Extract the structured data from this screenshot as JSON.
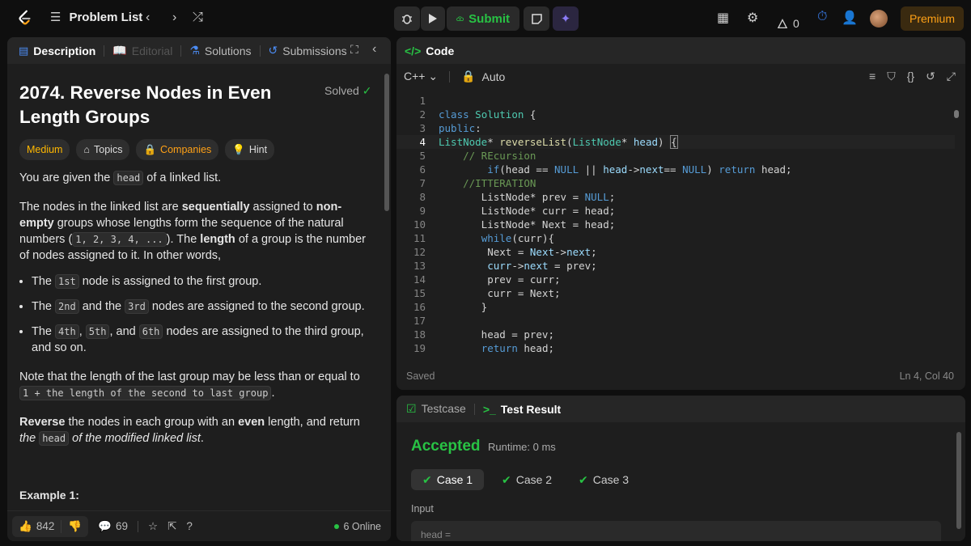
{
  "topbar": {
    "problem_list": "Problem List",
    "submit": "Submit",
    "streak": "0",
    "premium": "Premium"
  },
  "left_tabs": [
    {
      "label": "Description"
    },
    {
      "label": "Editorial"
    },
    {
      "label": "Solutions"
    },
    {
      "label": "Submissions"
    }
  ],
  "problem": {
    "title": "2074. Reverse Nodes in Even Length Groups",
    "status": "Solved",
    "chips": [
      "Medium",
      "Topics",
      "Companies",
      "Hint"
    ],
    "p1_a": "You are given the ",
    "p1_code": "head",
    "p1_b": " of a linked list.",
    "p2_a": "The nodes in the linked list are ",
    "p2_b1": "sequentially",
    "p2_c": " assigned to ",
    "p2_b2": "non-empty",
    "p2_d": " groups whose lengths form the sequence of the natural numbers (",
    "p2_code": "1, 2, 3, 4, ...",
    "p2_e": "). The ",
    "p2_b3": "length",
    "p2_f": " of a group is the number of nodes assigned to it. In other words,",
    "li1_a": "The ",
    "li1_code": "1st",
    "li1_b": " node is assigned to the first group.",
    "li2_a": "The ",
    "li2_code1": "2nd",
    "li2_b": " and the ",
    "li2_code2": "3rd",
    "li2_c": " nodes are assigned to the second group.",
    "li3_a": "The ",
    "li3_code1": "4th",
    "li3_b": ", ",
    "li3_code2": "5th",
    "li3_c": ", and ",
    "li3_code3": "6th",
    "li3_d": " nodes are assigned to the third group, and so on.",
    "p3_a": "Note that the length of the last group may be less than or equal to ",
    "p3_code": "1 + the length of the second to last group",
    "p3_b": ".",
    "p4_b1": "Reverse",
    "p4_a": " the nodes in each group with an ",
    "p4_b2": "even",
    "p4_c": " length, and return ",
    "p4_i1": "the",
    "p4_code": "head",
    "p4_i2": " of the modified linked list",
    "p4_d": ".",
    "example": "Example 1:"
  },
  "footer": {
    "likes": "842",
    "comments": "69",
    "online": "6 Online"
  },
  "code_panel": {
    "title": "Code",
    "language": "C++",
    "mode": "Auto",
    "status": "Saved",
    "cursor": "Ln 4, Col 40"
  },
  "result_panel": {
    "tab_testcase": "Testcase",
    "tab_result": "Test Result",
    "verdict": "Accepted",
    "runtime": "Runtime: 0 ms",
    "cases": [
      "Case 1",
      "Case 2",
      "Case 3"
    ],
    "input_label": "Input",
    "input_value": "head ="
  },
  "colors": {
    "accent": "#ffa116",
    "success": "#28c244",
    "bg": "#1e1e1e"
  }
}
